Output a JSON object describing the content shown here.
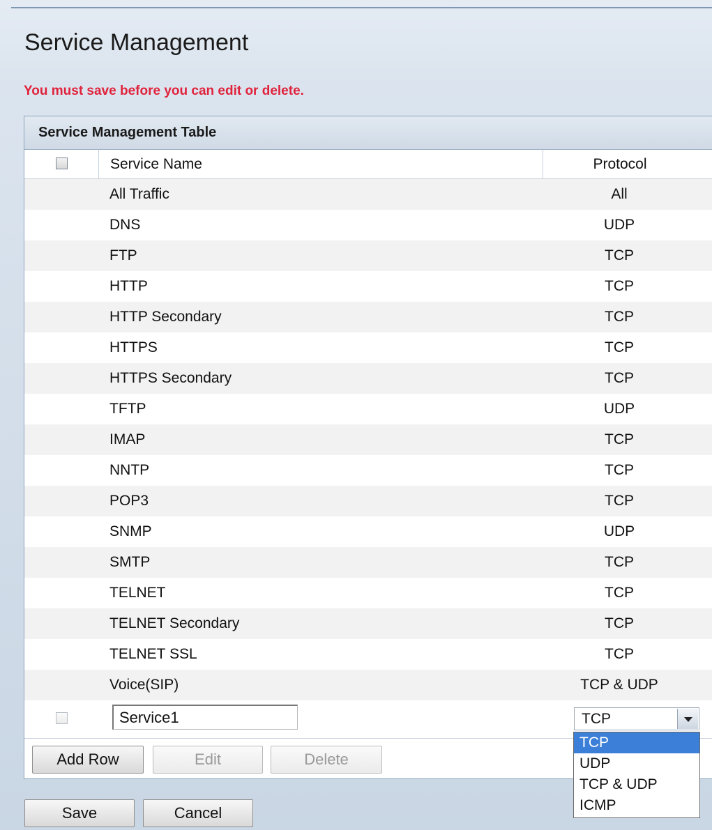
{
  "page": {
    "title": "Service Management",
    "warning": "You must save before you can edit or delete."
  },
  "table": {
    "caption": "Service Management Table",
    "headers": {
      "name": "Service Name",
      "protocol": "Protocol"
    },
    "rows": [
      {
        "name": "All Traffic",
        "protocol": "All"
      },
      {
        "name": "DNS",
        "protocol": "UDP"
      },
      {
        "name": "FTP",
        "protocol": "TCP"
      },
      {
        "name": "HTTP",
        "protocol": "TCP"
      },
      {
        "name": "HTTP Secondary",
        "protocol": "TCP"
      },
      {
        "name": "HTTPS",
        "protocol": "TCP"
      },
      {
        "name": "HTTPS Secondary",
        "protocol": "TCP"
      },
      {
        "name": "TFTP",
        "protocol": "UDP"
      },
      {
        "name": "IMAP",
        "protocol": "TCP"
      },
      {
        "name": "NNTP",
        "protocol": "TCP"
      },
      {
        "name": "POP3",
        "protocol": "TCP"
      },
      {
        "name": "SNMP",
        "protocol": "UDP"
      },
      {
        "name": "SMTP",
        "protocol": "TCP"
      },
      {
        "name": "TELNET",
        "protocol": "TCP"
      },
      {
        "name": "TELNET Secondary",
        "protocol": "TCP"
      },
      {
        "name": "TELNET SSL",
        "protocol": "TCP"
      },
      {
        "name": "Voice(SIP)",
        "protocol": "TCP & UDP"
      }
    ],
    "new_row": {
      "service_name_value": "Service1",
      "protocol_selected": "TCP",
      "protocol_options": [
        "TCP",
        "UDP",
        "TCP & UDP",
        "ICMP"
      ]
    },
    "buttons": {
      "add_row": "Add Row",
      "edit": "Edit",
      "delete": "Delete"
    }
  },
  "footer_buttons": {
    "save": "Save",
    "cancel": "Cancel"
  },
  "colors": {
    "warning": "#e0223c",
    "dropdown_highlight": "#3b7fd8",
    "row_alt": "#f2f2f2"
  }
}
